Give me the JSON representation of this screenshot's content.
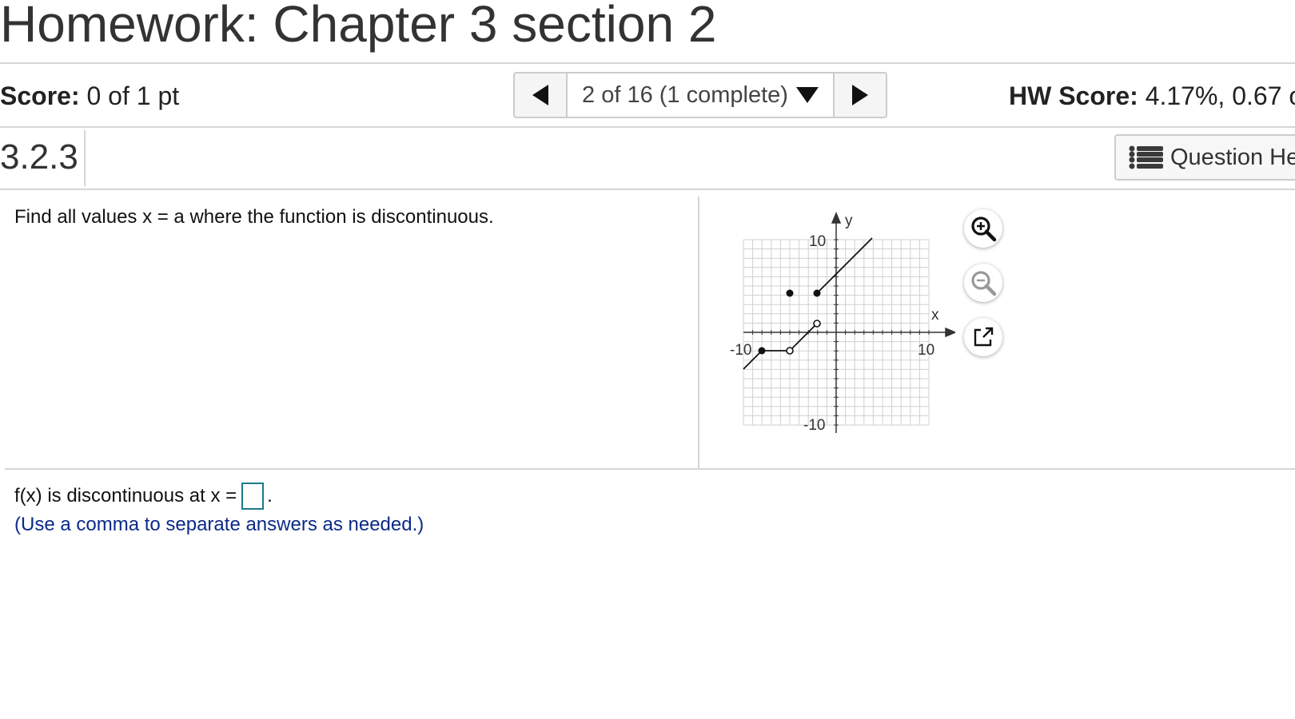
{
  "header": {
    "title": "Homework: Chapter 3 section 2"
  },
  "score": {
    "label": "Score:",
    "value": "0 of 1 pt"
  },
  "nav": {
    "position": "2 of 16 (1 complete)"
  },
  "hw_score": {
    "label": "HW Score:",
    "value": "4.17%, 0.67 o"
  },
  "question": {
    "number": "3.2.3",
    "help_label": "Question He",
    "prompt": "Find all values x = a where the function is discontinuous."
  },
  "graph": {
    "x_axis_label": "x",
    "y_axis_label": "y",
    "x_min_label": "-10",
    "x_max_label": "10",
    "y_max_label": "10",
    "y_min_label": "-10"
  },
  "answer": {
    "prefix": "f(x) is discontinuous at x =",
    "suffix": ".",
    "value": "",
    "hint": "(Use a comma to separate answers as needed.)"
  }
}
